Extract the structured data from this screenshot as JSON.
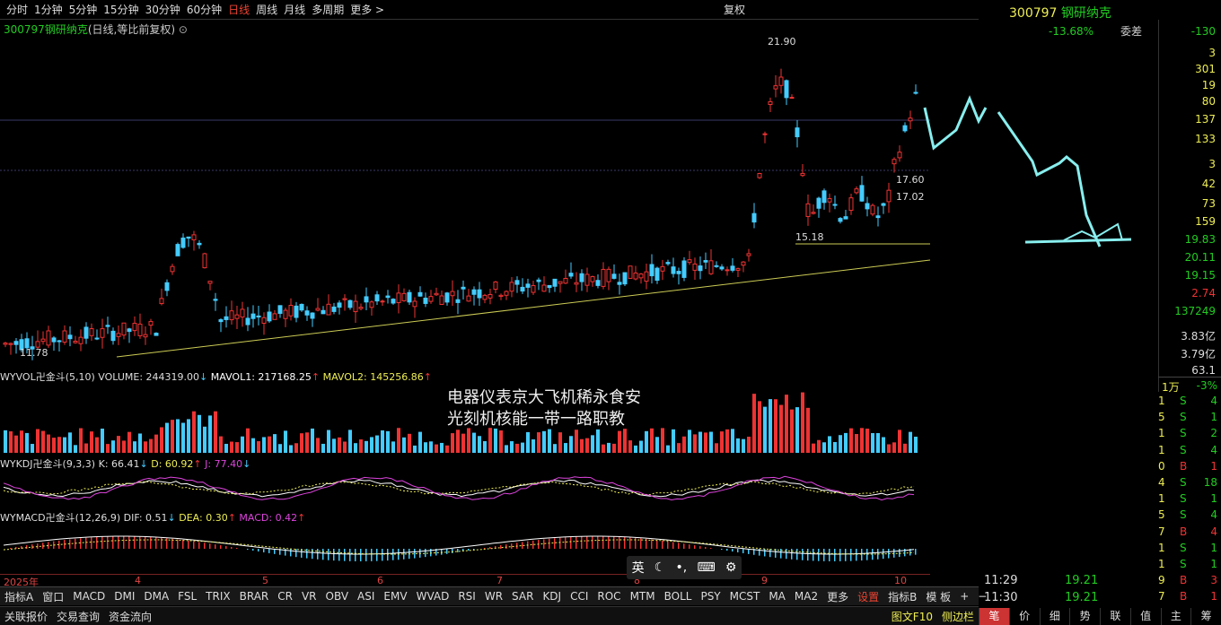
{
  "periods": [
    "分时",
    "1分钟",
    "5分钟",
    "15分钟",
    "30分钟",
    "60分钟",
    "日线",
    "周线",
    "月线",
    "多周期",
    "更多 >"
  ],
  "active_period": "日线",
  "reset_label": "复权",
  "stock": {
    "code": "300797",
    "name": "钢研纳克",
    "mode": "(日线,等比前复权)"
  },
  "price_labels": {
    "high": "21.90",
    "low": "11.78",
    "level1": "15.18",
    "box1": "17.60",
    "box2": "17.02"
  },
  "vol_header": {
    "name": "WYVOL卍金斗(5,10)",
    "volume": "VOLUME: 244319.00",
    "mavol1": "MAVOL1: 217168.25",
    "mavol2": "MAVOL2: 145256.86"
  },
  "kdj_header": {
    "name": "WYKDJ卍金斗(9,3,3)",
    "k": "K: 66.41",
    "d": "D: 60.92",
    "j": "J: 77.40"
  },
  "macd_header": {
    "name": "WYMACD卍金斗(12,26,9)",
    "dif": "DIF: 0.51",
    "dea": "DEA: 0.30",
    "macd": "MACD: 0.42"
  },
  "x_labels": {
    "year": "2025年",
    "m4": "4",
    "m5": "5",
    "m6": "6",
    "m7": "7",
    "m8": "8",
    "m9": "9",
    "m10": "10"
  },
  "news_lines": [
    "电器仪表京大飞机稀永食安",
    "光刻机核能一带一路职教"
  ],
  "ime": {
    "lang": "英"
  },
  "bottom1": [
    "指标A",
    "窗口",
    "MACD",
    "DMI",
    "DMA",
    "FSL",
    "TRIX",
    "BRAR",
    "CR",
    "VR",
    "OBV",
    "ASI",
    "EMV",
    "WVAD",
    "RSI",
    "WR",
    "SAR",
    "KDJ",
    "CCI",
    "ROC",
    "MTM",
    "BOLL",
    "PSY",
    "MCST",
    "MA",
    "MA2",
    "更多",
    "设置",
    "指标B",
    "模 板",
    "+",
    "−"
  ],
  "bottom2": [
    "关联报价",
    "交易查询",
    "资金流向"
  ],
  "bottom2_right": [
    "图文F10",
    "侧边栏"
  ],
  "right": {
    "code": "300797",
    "name": "钢研纳克",
    "row1a": "-13.68%",
    "row1b": "委差",
    "row1c": "-130",
    "vals": [
      "3",
      "301",
      "19",
      "80",
      "137",
      "133",
      "3",
      "42",
      "73",
      "159",
      "19.83",
      "20.11",
      "19.15",
      "2.74",
      "137249",
      "3.83亿",
      "3.79亿",
      "63.1"
    ],
    "unit": "1万",
    "pct": "-3%",
    "times": [
      "11:29",
      "11:30"
    ],
    "tprices": [
      "19.21",
      "19.21"
    ]
  },
  "ticks": [
    [
      "1",
      "S",
      "4"
    ],
    [
      "5",
      "S",
      "1"
    ],
    [
      "1",
      "S",
      "2"
    ],
    [
      "1",
      "S",
      "4"
    ],
    [
      "0",
      "B",
      "1"
    ],
    [
      "4",
      "S",
      "18"
    ],
    [
      "1",
      "S",
      "1"
    ],
    [
      "5",
      "S",
      "4"
    ],
    [
      "7",
      "B",
      "4"
    ],
    [
      "1",
      "S",
      "1"
    ],
    [
      "1",
      "S",
      "1"
    ],
    [
      "9",
      "B",
      "3"
    ],
    [
      "7",
      "B",
      "1"
    ]
  ],
  "side_tabs": [
    "笔",
    "价",
    "细",
    "势",
    "联",
    "值",
    "主",
    "筹"
  ],
  "chart_data": {
    "type": "candlestick",
    "title": "300797 钢研纳克 (日线,等比前复权)",
    "ylim": [
      11.5,
      22.3
    ],
    "high": 21.9,
    "low": 11.78,
    "support": 15.18
  }
}
